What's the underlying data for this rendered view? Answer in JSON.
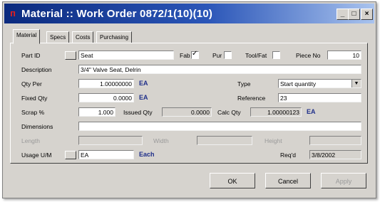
{
  "window": {
    "title": "Material :: Work Order 0872/1(10)(10)",
    "controls": {
      "minimize": "_",
      "maximize": "□",
      "close": "×"
    }
  },
  "tabs": [
    "Material",
    "Specs",
    "Costs",
    "Purchasing"
  ],
  "form": {
    "part_id": {
      "label": "Part ID",
      "value": "Seat"
    },
    "fab": {
      "label": "Fab",
      "checked": true
    },
    "pur": {
      "label": "Pur",
      "checked": false
    },
    "tool_fat": {
      "label": "Tool/Fat",
      "checked": false
    },
    "piece_no": {
      "label": "Piece No",
      "value": "10"
    },
    "description": {
      "label": "Description",
      "value": "3/4\" Valve Seat, Delrin"
    },
    "qty_per": {
      "label": "Qty Per",
      "value": "1.00000000",
      "unit": "EA"
    },
    "type": {
      "label": "Type",
      "value": "Start quantity"
    },
    "fixed_qty": {
      "label": "Fixed Qty",
      "value": "0.0000",
      "unit": "EA"
    },
    "reference": {
      "label": "Reference",
      "value": "23"
    },
    "scrap": {
      "label": "Scrap %",
      "value": "1.000"
    },
    "issued_qty": {
      "label": "Issued Qty",
      "value": "0.0000"
    },
    "calc_qty": {
      "label": "Calc Qty",
      "value": "1.00000123",
      "unit": "EA"
    },
    "dimensions": {
      "label": "Dimensions",
      "value": ""
    },
    "length": {
      "label": "Length",
      "value": ""
    },
    "width": {
      "label": "Width",
      "value": ""
    },
    "height": {
      "label": "Height",
      "value": ""
    },
    "usage_um": {
      "label": "Usage U/M",
      "value": "EA",
      "unit": "Each"
    },
    "reqd": {
      "label": "Req'd",
      "value": "3/8/2002"
    }
  },
  "buttons": {
    "ok": "OK",
    "cancel": "Cancel",
    "apply": "Apply"
  }
}
